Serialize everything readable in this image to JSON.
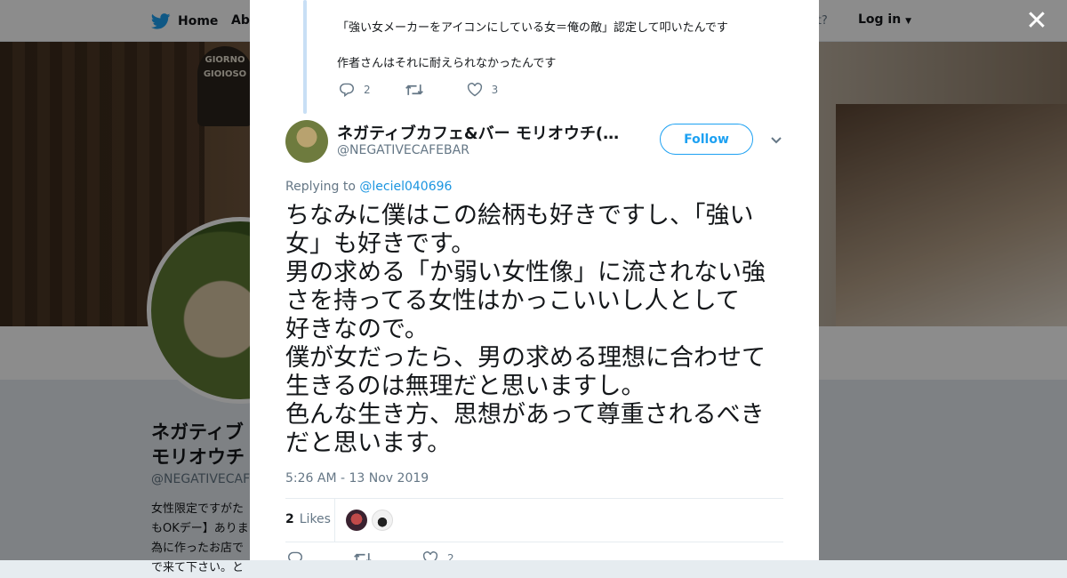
{
  "background": {
    "nav": {
      "home_label": "Home",
      "about_label": "Abo",
      "account_prompt": "ccount?",
      "login_label": "Log in"
    },
    "banner_sign": "GIORNO GIOIOSO",
    "profile": {
      "name": "ネガティブ\nモリオウチ",
      "handle": "@NEGATIVECAFE",
      "bio": "女性限定ですがた\nもOKデー】ありま\n為に作ったお店で\nで来て下さい。と"
    }
  },
  "parent_tweet": {
    "lines": [
      "「強い女メーカーをアイコンにしている女＝俺の敵」認定して叩いたんです",
      "作者さんはそれに耐えられなかったんです"
    ],
    "reply_count": "2",
    "retweet_count": "",
    "like_count": "3"
  },
  "tweet": {
    "author_name": "ネガティブカフェ&バー モリオウチ(…",
    "author_handle": "@NEGATIVECAFEBAR",
    "follow_label": "Follow",
    "replying_prefix": "Replying to",
    "replying_to": "@leciel040696",
    "text_lines": [
      "ちなみに僕はこの絵柄も好きですし、「強い",
      "女」も好きです。",
      "男の求める「か弱い女性像」に流されない強",
      "さを持ってる女性はかっこいいし人として",
      "好きなので。",
      "僕が女だったら、男の求める理想に合わせて",
      "生きるのは無理だと思いますし。",
      "色んな生き方、思想があって尊重されるべき",
      "だと思います。"
    ],
    "timestamp": "5:26 AM - 13 Nov 2019",
    "likes_count": "2",
    "likes_label": "Likes",
    "bottom_reply_count": "",
    "bottom_retweet_count": "",
    "bottom_like_count": "2"
  },
  "icons": {
    "brand": "twitter-bird-icon",
    "close": "close-icon",
    "reply": "reply-icon",
    "retweet": "retweet-icon",
    "like": "heart-icon",
    "caret": "chevron-down-icon"
  },
  "colors": {
    "accent": "#1da1f2",
    "link": "#1b95e0",
    "thread_line": "#c8dff5",
    "secondary_text": "#657786",
    "primary_text": "#14171a"
  }
}
